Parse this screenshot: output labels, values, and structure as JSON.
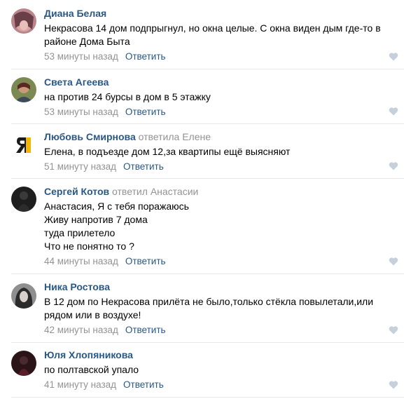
{
  "colors": {
    "author": "#2a5885",
    "meta": "#939393",
    "divider": "#e7e8ec",
    "like_icon": "#c5d0db"
  },
  "comments": [
    {
      "author": "Диана Белая",
      "reply_to": "",
      "lines": [
        "Некрасова 14 дом подпрыгнул, но окна целые. С окна виден дым где-то в",
        "районе Дома Быта"
      ],
      "time": "53 минуты назад",
      "reply_label": "Ответить",
      "avatar_icon": "user-photo"
    },
    {
      "author": "Света Агеева",
      "reply_to": "",
      "lines": [
        "на против 24 бурсы в дом в 5 этажку"
      ],
      "time": "53 минуты назад",
      "reply_label": "Ответить",
      "avatar_icon": "user-photo"
    },
    {
      "author": "Любовь Смирнова",
      "reply_to": "ответила Елене",
      "lines": [
        "Елена, в подъезде дом 12,за квартипы ещё выясняют"
      ],
      "time": "51 минуту назад",
      "reply_label": "Ответить",
      "avatar_icon": "letter-ya-logo"
    },
    {
      "author": "Сергей Котов",
      "reply_to": "ответил Анастасии",
      "lines": [
        "Анастасия, Я с тебя поражаюсь",
        "Живу напротив 7 дома",
        "туда прилетело",
        "Что не понятно то ?"
      ],
      "time": "44 минуты назад",
      "reply_label": "Ответить",
      "avatar_icon": "user-photo"
    },
    {
      "author": "Ника Ростова",
      "reply_to": "",
      "lines": [
        "В 12 дом по Некрасова прилёта не было,только стёкла повылетали,или",
        "рядом или в воздухе!"
      ],
      "time": "42 минуты назад",
      "reply_label": "Ответить",
      "avatar_icon": "user-photo"
    },
    {
      "author": "Юля Хлопяникова",
      "reply_to": "",
      "lines": [
        "по полтавской упало"
      ],
      "time": "41 минуту назад",
      "reply_label": "Ответить",
      "avatar_icon": "user-photo"
    }
  ]
}
